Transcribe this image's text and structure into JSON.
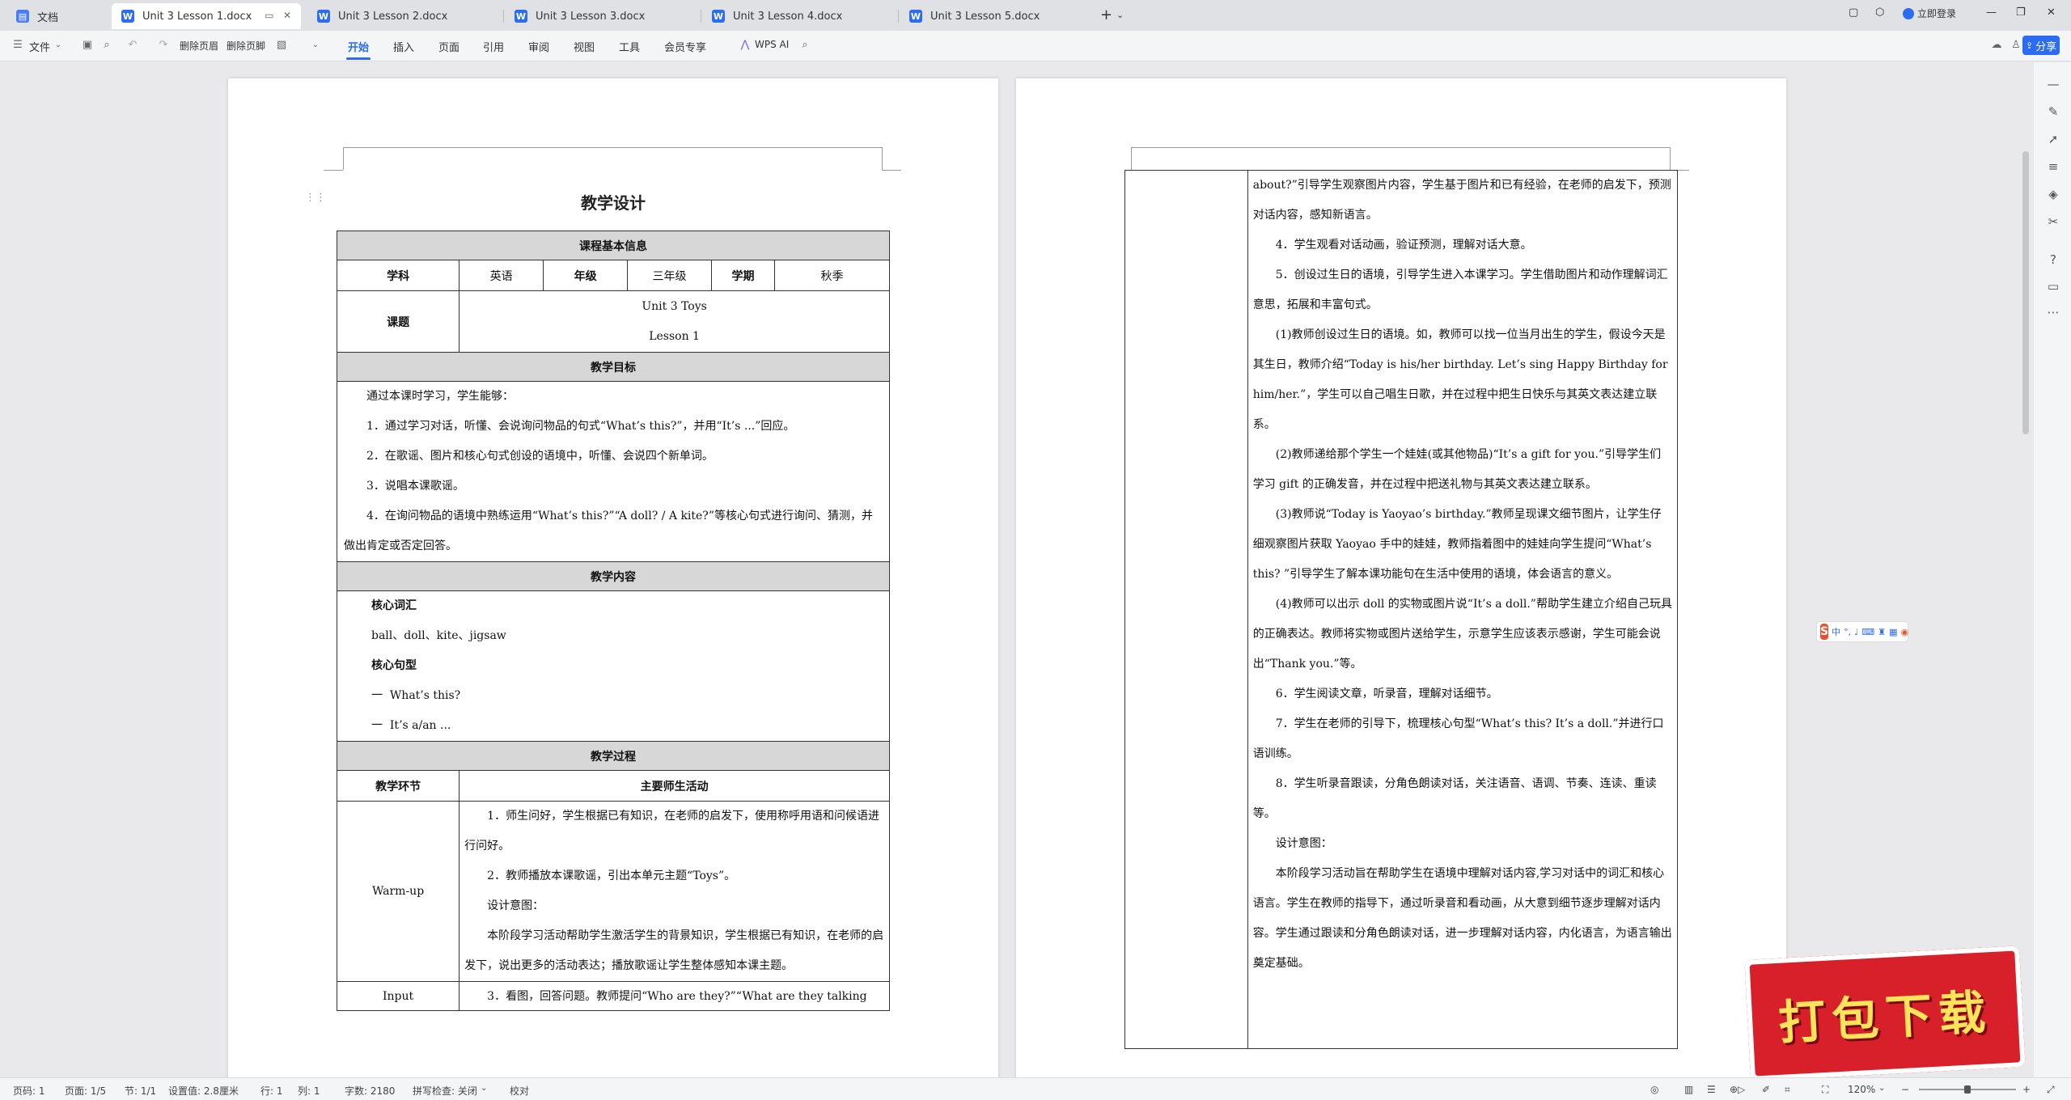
{
  "tabs": [
    {
      "label": "文档",
      "icon": "home-doc-icon"
    },
    {
      "label": "Unit 3 Lesson 1.docx",
      "icon": "wps-writer-icon",
      "active": true
    },
    {
      "label": "Unit 3 Lesson 2.docx",
      "icon": "wps-writer-icon"
    },
    {
      "label": "Unit 3 Lesson 3.docx",
      "icon": "wps-writer-icon"
    },
    {
      "label": "Unit 3 Lesson 4.docx",
      "icon": "wps-writer-icon"
    },
    {
      "label": "Unit 3 Lesson 5.docx",
      "icon": "wps-writer-icon"
    }
  ],
  "topright": {
    "login": "立即登录"
  },
  "menu": {
    "file": "文件",
    "delete_header": "删除页眉",
    "delete_footer": "删除页脚",
    "items": [
      "开始",
      "插入",
      "页面",
      "引用",
      "审阅",
      "视图",
      "工具",
      "会员专享"
    ],
    "wps_ai": "WPS AI",
    "share": "分享"
  },
  "page1": {
    "title": "教学设计",
    "basic_info_header": "课程基本信息",
    "subject_label": "学科",
    "subject": "英语",
    "grade_label": "年级",
    "grade": "三年级",
    "term_label": "学期",
    "term": "秋季",
    "topic_label": "课题",
    "topic_line1": "Unit 3 Toys",
    "topic_line2": "Lesson 1",
    "goals_header": "教学目标",
    "goals": [
      "通过本课时学习，学生能够：",
      "1．通过学习对话，听懂、会说询问物品的句式“What’s this?”，并用“It’s ...”回应。",
      "2．在歌谣、图片和核心句式创设的语境中，听懂、会说四个新单词。",
      "3．说唱本课歌谣。",
      "4．在询问物品的语境中熟练运用“What’s this?”“A doll? / A kite?”等核心句式进行询问、猜测，并做出肯定或否定回答。"
    ],
    "content_header": "教学内容",
    "vocab_label": "核心词汇",
    "vocab": "ball、doll、kite、jigsaw",
    "pattern_label": "核心句型",
    "patterns": [
      "What’s this?",
      "It’s a/an ..."
    ],
    "process_header": "教学过程",
    "stage_col": "教学环节",
    "activity_col": "主要师生活动",
    "warmup_label": "Warm-up",
    "warmup": [
      "1．师生问好，学生根据已有知识，在老师的启发下，使用称呼用语和问候语进行问好。",
      "2．教师播放本课歌谣，引出本单元主题“Toys”。",
      "设计意图：",
      "本阶段学习活动帮助学生激活学生的背景知识，学生根据已有知识，在老师的启发下，说出更多的活动表达；播放歌谣让学生整体感知本课主题。"
    ],
    "input_label": "Input",
    "input_first": "3．看图，回答问题。教师提问“Who are they?”“What are they talking"
  },
  "page2": {
    "lines": [
      "about?”引导学生观察图片内容，学生基于图片和已有经验，在老师的启发下，预测对话内容，感知新语言。",
      "4．学生观看对话动画，验证预测，理解对话大意。",
      "5．创设过生日的语境，引导学生进入本课学习。学生借助图片和动作理解词汇意思，拓展和丰富句式。",
      "(1)教师创设过生日的语境。如，教师可以找一位当月出生的学生，假设今天是其生日，教师介绍“Today is his/her birthday. Let’s sing Happy Birthday for him/her.”，学生可以自己唱生日歌，并在过程中把生日快乐与其英文表达建立联系。",
      "(2)教师递给那个学生一个娃娃(或其他物品)“It’s a gift for you.”引导学生们学习 gift 的正确发音，并在过程中把送礼物与其英文表达建立联系。",
      "(3)教师说“Today is Yaoyao’s birthday.”教师呈现课文细节图片，让学生仔细观察图片获取 Yaoyao 手中的娃娃，教师指着图中的娃娃向学生提问“What’s this? ”引导学生了解本课功能句在生活中使用的语境，体会语言的意义。",
      "(4)教师可以出示 doll 的实物或图片说“It’s a doll.”帮助学生建立介绍自己玩具的正确表达。教师将实物或图片送给学生，示意学生应该表示感谢，学生可能会说出“Thank you.”等。",
      "6．学生阅读文章，听录音，理解对话细节。",
      "7．学生在老师的引导下，梳理核心句型“What’s this? It’s a doll.”并进行口语训练。",
      "8．学生听录音跟读，分角色朗读对话，关注语音、语调、节奏、连读、重读等。",
      "设计意图：",
      "本阶段学习活动旨在帮助学生在语境中理解对话内容,学习对话中的词汇和核心语言。学生在教师的指导下，通过听录音和看动画，从大意到细节逐步理解对话内容。学生通过跟读和分角色朗读对话，进一步理解对话内容，内化语言，为语言输出奠定基础。"
    ]
  },
  "status": {
    "page_num": "页码: 1",
    "pages": "页面: 1/5",
    "section": "节: 1/1",
    "setting": "设置值: 2.8厘米",
    "row": "行: 1",
    "col": "列: 1",
    "words": "字数: 2180",
    "spell": "拼写检查: 关闭",
    "proof": "校对",
    "zoom": "120%"
  },
  "promo": {
    "text": "打包下载"
  },
  "colors": {
    "accent": "#2b6cf0",
    "header_fill": "#d7d7d7",
    "promo_red": "#d8202a"
  }
}
